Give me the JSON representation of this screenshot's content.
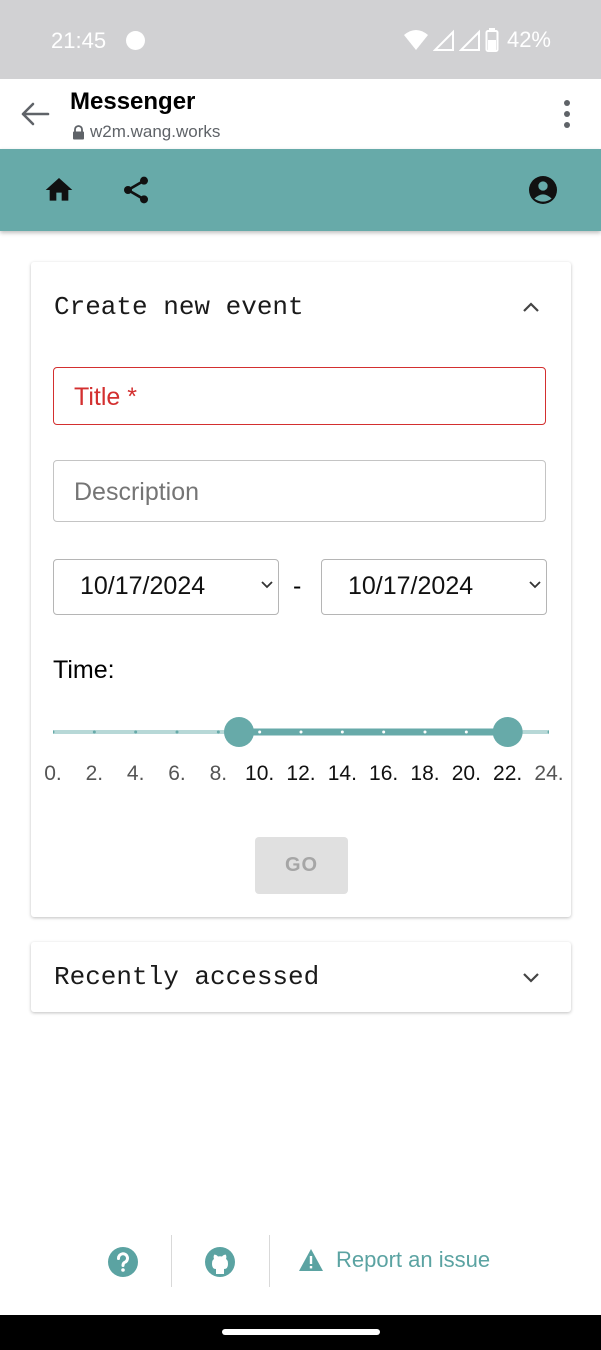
{
  "status_bar": {
    "time": "21:45",
    "battery": "42%"
  },
  "browser": {
    "title": "Messenger",
    "url": "w2m.wang.works"
  },
  "create_card": {
    "title": "Create new event",
    "title_field_label": "Title *",
    "description_placeholder": "Description",
    "start_date": "10/17/2024",
    "end_date": "10/17/2024",
    "date_separator": "-",
    "time_label": "Time:",
    "time_range": {
      "min": 0,
      "max": 24,
      "start": 9,
      "end": 22
    },
    "tick_labels": [
      "0.",
      "2.",
      "4.",
      "6.",
      "8.",
      "10.",
      "12.",
      "14.",
      "16.",
      "18.",
      "20.",
      "22.",
      "24."
    ],
    "go_label": "GO"
  },
  "recent_card": {
    "title": "Recently accessed"
  },
  "footer": {
    "report_label": "Report an issue"
  },
  "colors": {
    "accent": "#67aaa9",
    "error": "#d32f2f",
    "status_bar": "#d1d1d3"
  },
  "icons": [
    "back-arrow-icon",
    "lock-icon",
    "more-vert-icon",
    "home-icon",
    "share-icon",
    "account-icon",
    "chevron-up-icon",
    "chevron-down-icon",
    "help-icon",
    "github-icon",
    "warning-icon"
  ]
}
